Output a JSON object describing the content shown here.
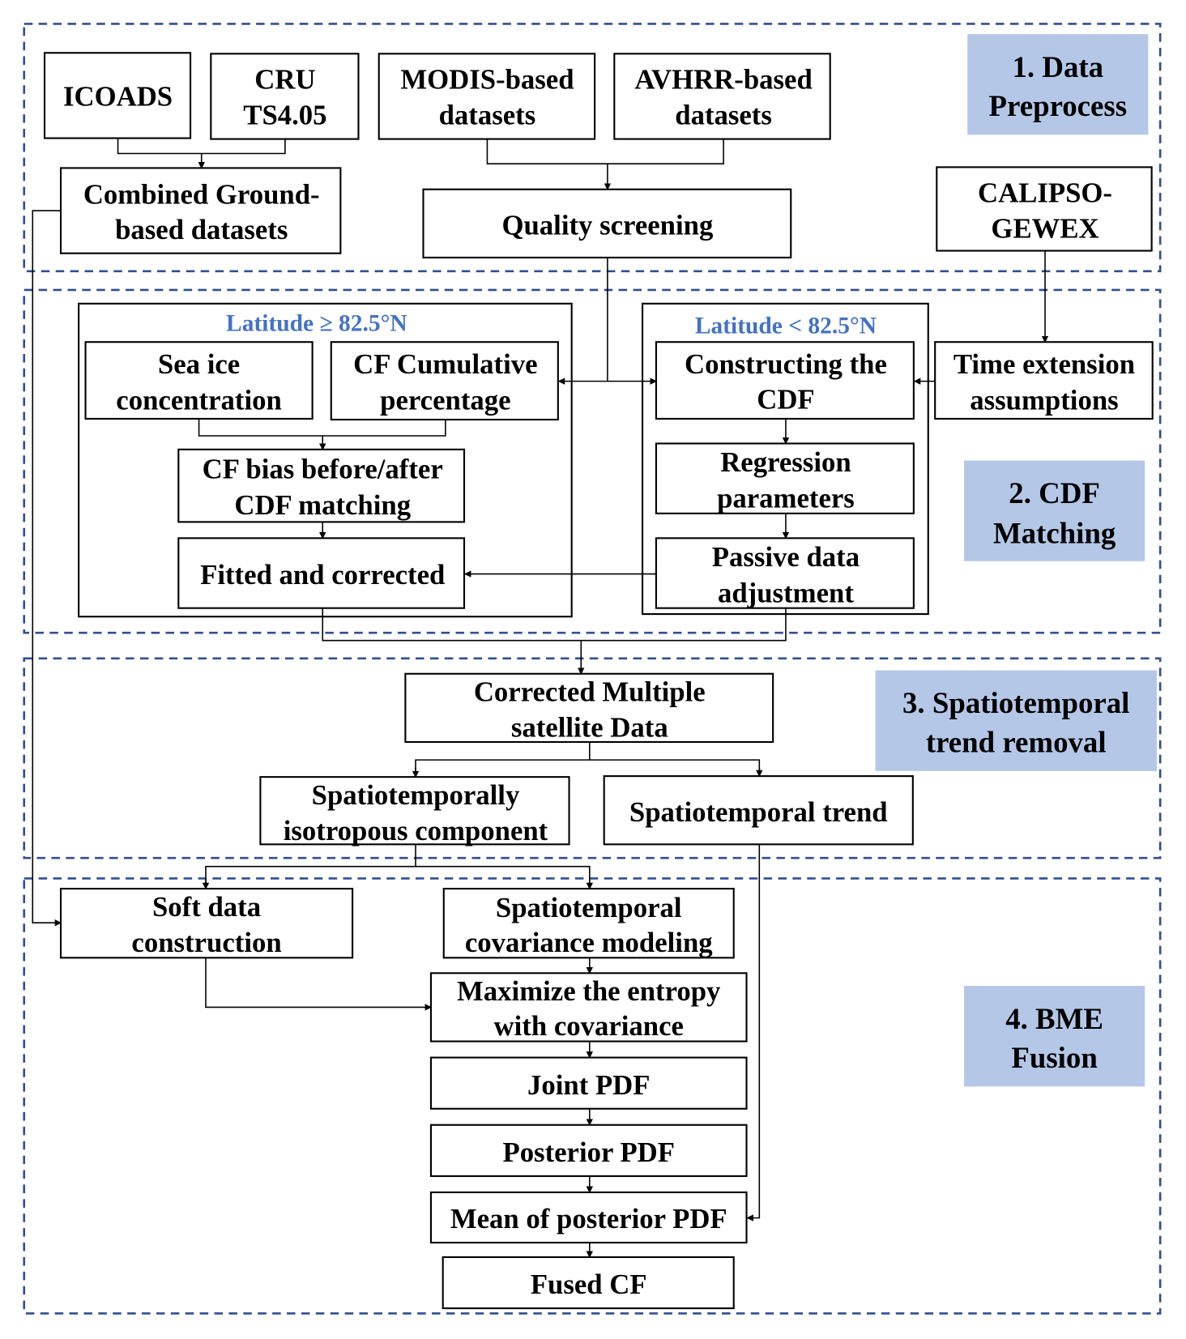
{
  "colors": {
    "section_border": "#2f4f8f",
    "stage_label_fill": "#b4c7e7",
    "latitude_text": "#4472c4"
  },
  "stages": {
    "s1": [
      "1. Data",
      "Preprocess"
    ],
    "s2": [
      "2. CDF",
      "Matching"
    ],
    "s3": [
      "3. Spatiotemporal",
      "trend removal"
    ],
    "s4": [
      "4. BME",
      "Fusion"
    ]
  },
  "groups": {
    "high_lat": "Latitude ≥ 82.5°N",
    "low_lat": "Latitude < 82.5°N"
  },
  "boxes": {
    "icoads": [
      "ICOADS"
    ],
    "cru": [
      "CRU",
      "TS4.05"
    ],
    "modis": [
      "MODIS-based",
      "datasets"
    ],
    "avhrr": [
      "AVHRR-based",
      "datasets"
    ],
    "combined": [
      "Combined Ground-",
      "based datasets"
    ],
    "quality": [
      "Quality screening"
    ],
    "calipso": [
      "CALIPSO-",
      "GEWEX"
    ],
    "sea_ice": [
      "Sea ice",
      "concentration"
    ],
    "cf_cum": [
      "CF Cumulative",
      "percentage"
    ],
    "cf_bias": [
      "CF bias before/after",
      "CDF matching"
    ],
    "fitted": [
      "Fitted and corrected"
    ],
    "constructing": [
      "Constructing the",
      "CDF"
    ],
    "regression": [
      "Regression",
      "parameters"
    ],
    "passive": [
      "Passive data",
      "adjustment"
    ],
    "time_ext": [
      "Time extension",
      "assumptions"
    ],
    "corrected": [
      "Corrected Multiple",
      "satellite Data"
    ],
    "isotropous": [
      "Spatiotemporally",
      "isotropous component"
    ],
    "trend": [
      "Spatiotemporal trend"
    ],
    "soft": [
      "Soft data",
      "construction"
    ],
    "covariance": [
      "Spatiotemporal",
      "covariance modeling"
    ],
    "maximize": [
      "Maximize the entropy",
      "with covariance"
    ],
    "joint": [
      "Joint PDF"
    ],
    "posterior": [
      "Posterior PDF"
    ],
    "mean": [
      "Mean of posterior PDF"
    ],
    "fused": [
      "Fused CF"
    ]
  }
}
